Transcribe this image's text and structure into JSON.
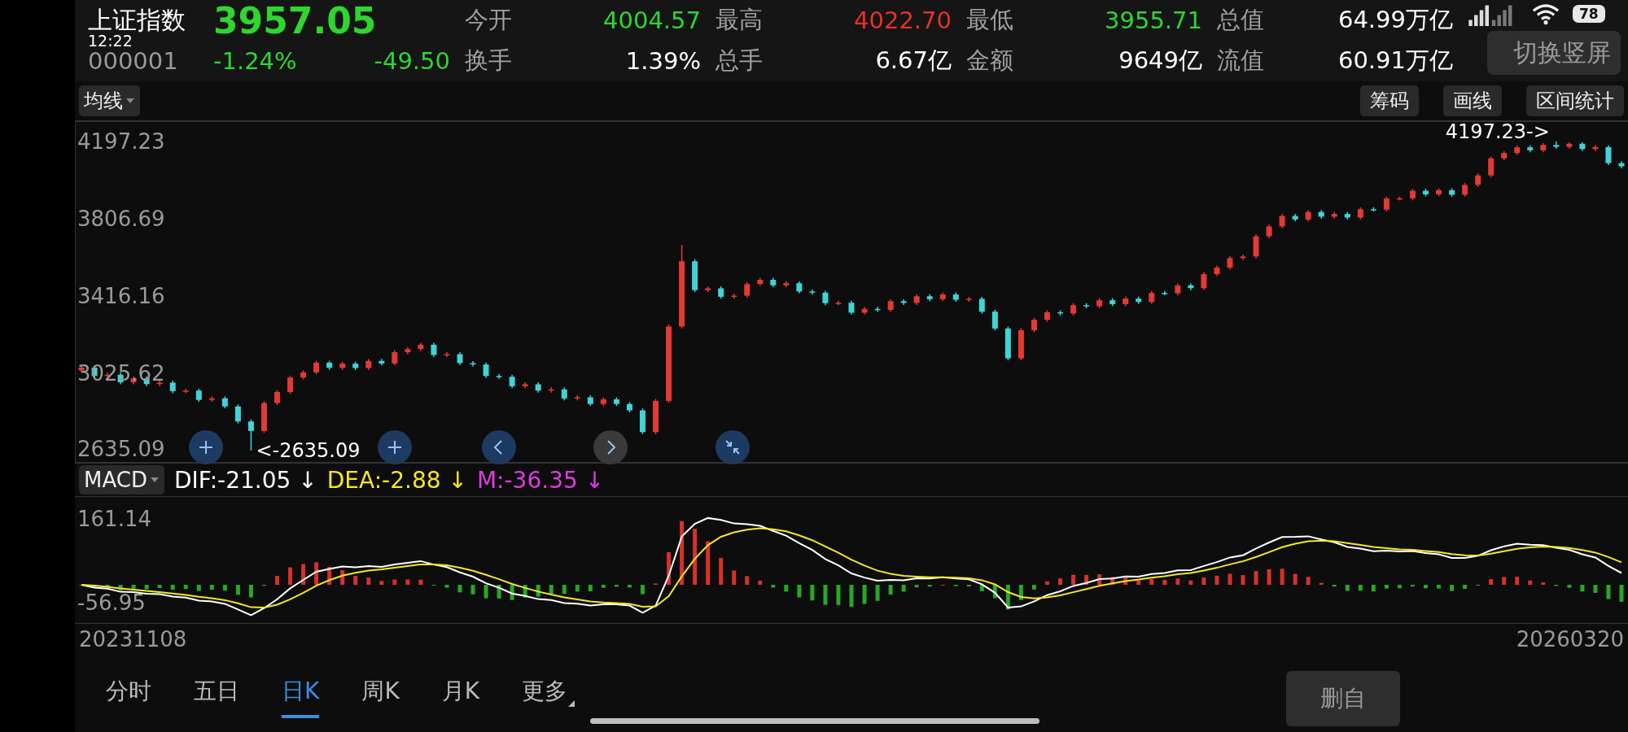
{
  "status_bar": {
    "time": "12:22",
    "battery": "78"
  },
  "quote": {
    "name": "上证指数",
    "code": "000001",
    "price": "3957.05",
    "change_percent": "-1.24%",
    "change": "-49.50",
    "color": "#2ed62e"
  },
  "stats": [
    {
      "label": "今开",
      "value": "4004.57",
      "color": "#2ed62e"
    },
    {
      "label": "最高",
      "value": "4022.70",
      "color": "#e8302a"
    },
    {
      "label": "最低",
      "value": "3955.71",
      "color": "#2ed62e"
    },
    {
      "label": "总值",
      "value": "64.99万亿",
      "color": "#ffffff"
    },
    {
      "label": "换手",
      "value": "1.39%",
      "color": "#ffffff"
    },
    {
      "label": "总手",
      "value": "6.67亿",
      "color": "#ffffff"
    },
    {
      "label": "金额",
      "value": "9649亿",
      "color": "#ffffff"
    },
    {
      "label": "流值",
      "value": "60.91万亿",
      "color": "#ffffff"
    }
  ],
  "orientation_button": "切换竖屏",
  "toolbar": {
    "indicator_dropdown": "均线",
    "buttons": [
      "筹码",
      "画线",
      "区间统计"
    ]
  },
  "chart": {
    "chart_data": {
      "type": "candlestick",
      "ylim": [
        2573,
        4300
      ],
      "yticks": [
        4197.23,
        3806.69,
        3416.16,
        3025.62,
        2635.09
      ],
      "annotations": [
        "<-2635.09",
        "4197.23->"
      ],
      "ohlc": [
        [
          3040,
          3064,
          3030,
          3054
        ],
        [
          3054,
          3064,
          3002,
          3012
        ],
        [
          3012,
          3028,
          3002,
          3018
        ],
        [
          3018,
          3028,
          2970,
          2980
        ],
        [
          2980,
          3010,
          2970,
          3000
        ],
        [
          3000,
          3010,
          2961,
          2971
        ],
        [
          2971,
          2988,
          2961,
          2978
        ],
        [
          2978,
          2988,
          2925,
          2935
        ],
        [
          2935,
          2948,
          2925,
          2938
        ],
        [
          2938,
          2948,
          2881,
          2891
        ],
        [
          2891,
          2909,
          2881,
          2899
        ],
        [
          2899,
          2909,
          2848,
          2858
        ],
        [
          2858,
          2868,
          2772,
          2782
        ],
        [
          2782,
          2792,
          2635.09,
          2734
        ],
        [
          2734,
          2885,
          2724,
          2875
        ],
        [
          2875,
          2941,
          2865,
          2931
        ],
        [
          2931,
          3014,
          2921,
          3004
        ],
        [
          3004,
          3040,
          2994,
          3030
        ],
        [
          3030,
          3089,
          3020,
          3079
        ],
        [
          3079,
          3089,
          3043,
          3053
        ],
        [
          3053,
          3084,
          3043,
          3074
        ],
        [
          3074,
          3084,
          3042,
          3052
        ],
        [
          3052,
          3098,
          3042,
          3088
        ],
        [
          3088,
          3098,
          3065,
          3075
        ],
        [
          3075,
          3142,
          3065,
          3132
        ],
        [
          3132,
          3158,
          3122,
          3148
        ],
        [
          3148,
          3180,
          3138,
          3170
        ],
        [
          3170,
          3180,
          3108,
          3118
        ],
        [
          3118,
          3132,
          3108,
          3122
        ],
        [
          3122,
          3132,
          3067,
          3077
        ],
        [
          3077,
          3087,
          3060,
          3070
        ],
        [
          3070,
          3080,
          3002,
          3012
        ],
        [
          3012,
          3022,
          2998,
          3008
        ],
        [
          3008,
          3018,
          2950,
          2960
        ],
        [
          2960,
          2980,
          2950,
          2970
        ],
        [
          2970,
          2980,
          2928,
          2938
        ],
        [
          2938,
          2954,
          2928,
          2944
        ],
        [
          2944,
          2954,
          2888,
          2898
        ],
        [
          2898,
          2914,
          2888,
          2904
        ],
        [
          2904,
          2914,
          2860,
          2870
        ],
        [
          2870,
          2904,
          2860,
          2894
        ],
        [
          2894,
          2904,
          2860,
          2870
        ],
        [
          2870,
          2880,
          2828,
          2838
        ],
        [
          2838,
          2848,
          2718,
          2728
        ],
        [
          2728,
          2896,
          2718,
          2886
        ],
        [
          2886,
          3272,
          2876,
          3262
        ],
        [
          3262,
          3674,
          3252,
          3592
        ],
        [
          3592,
          3602,
          3436,
          3446
        ],
        [
          3446,
          3465,
          3436,
          3455
        ],
        [
          3455,
          3465,
          3402,
          3412
        ],
        [
          3412,
          3428,
          3402,
          3418
        ],
        [
          3418,
          3487,
          3408,
          3477
        ],
        [
          3477,
          3508,
          3467,
          3498
        ],
        [
          3498,
          3508,
          3460,
          3470
        ],
        [
          3470,
          3491,
          3460,
          3481
        ],
        [
          3481,
          3491,
          3429,
          3439
        ],
        [
          3439,
          3449,
          3423,
          3433
        ],
        [
          3433,
          3443,
          3370,
          3380
        ],
        [
          3380,
          3392,
          3370,
          3382
        ],
        [
          3382,
          3392,
          3322,
          3332
        ],
        [
          3332,
          3361,
          3322,
          3351
        ],
        [
          3351,
          3361,
          3336,
          3346
        ],
        [
          3346,
          3400,
          3336,
          3390
        ],
        [
          3390,
          3400,
          3371,
          3381
        ],
        [
          3381,
          3425,
          3371,
          3415
        ],
        [
          3415,
          3425,
          3390,
          3400
        ],
        [
          3400,
          3434,
          3390,
          3424
        ],
        [
          3424,
          3434,
          3387,
          3397
        ],
        [
          3397,
          3412,
          3387,
          3402
        ],
        [
          3402,
          3412,
          3327,
          3337
        ],
        [
          3337,
          3347,
          3242,
          3252
        ],
        [
          3252,
          3262,
          3091,
          3101
        ],
        [
          3101,
          3253,
          3091,
          3243
        ],
        [
          3243,
          3306,
          3233,
          3296
        ],
        [
          3296,
          3344,
          3286,
          3334
        ],
        [
          3334,
          3344,
          3318,
          3328
        ],
        [
          3328,
          3380,
          3318,
          3370
        ],
        [
          3370,
          3380,
          3354,
          3364
        ],
        [
          3364,
          3405,
          3354,
          3395
        ],
        [
          3395,
          3405,
          3365,
          3375
        ],
        [
          3375,
          3413,
          3365,
          3403
        ],
        [
          3403,
          3413,
          3376,
          3386
        ],
        [
          3386,
          3442,
          3376,
          3432
        ],
        [
          3432,
          3442,
          3420,
          3430
        ],
        [
          3430,
          3480,
          3420,
          3470
        ],
        [
          3470,
          3480,
          3446,
          3456
        ],
        [
          3456,
          3537,
          3446,
          3527
        ],
        [
          3527,
          3570,
          3517,
          3560
        ],
        [
          3560,
          3618,
          3550,
          3608
        ],
        [
          3608,
          3626,
          3598,
          3616
        ],
        [
          3616,
          3728,
          3606,
          3718
        ],
        [
          3718,
          3778,
          3708,
          3768
        ],
        [
          3768,
          3831,
          3758,
          3821
        ],
        [
          3821,
          3831,
          3793,
          3803
        ],
        [
          3803,
          3851,
          3793,
          3841
        ],
        [
          3841,
          3851,
          3807,
          3817
        ],
        [
          3817,
          3841,
          3807,
          3831
        ],
        [
          3831,
          3841,
          3803,
          3813
        ],
        [
          3813,
          3865,
          3803,
          3855
        ],
        [
          3855,
          3865,
          3843,
          3853
        ],
        [
          3853,
          3919,
          3843,
          3909
        ],
        [
          3909,
          3919,
          3900,
          3910
        ],
        [
          3910,
          3958,
          3900,
          3948
        ],
        [
          3948,
          3958,
          3920,
          3930
        ],
        [
          3930,
          3961,
          3920,
          3951
        ],
        [
          3951,
          3961,
          3918,
          3928
        ],
        [
          3928,
          3988,
          3918,
          3978
        ],
        [
          3978,
          4036,
          3968,
          4026
        ],
        [
          4026,
          4122,
          4016,
          4112
        ],
        [
          4112,
          4149,
          4102,
          4139
        ],
        [
          4139,
          4178,
          4129,
          4168
        ],
        [
          4168,
          4178,
          4143,
          4153
        ],
        [
          4153,
          4190,
          4143,
          4180
        ],
        [
          4180,
          4197.23,
          4160,
          4170
        ],
        [
          4170,
          4193,
          4160,
          4186
        ],
        [
          4186,
          4193,
          4149,
          4159
        ],
        [
          4159,
          4179,
          4149,
          4169
        ],
        [
          4169,
          4179,
          4078,
          4088
        ],
        [
          4088,
          4098,
          4062,
          4072
        ]
      ]
    }
  },
  "macd": {
    "dropdown": "MACD",
    "legend": [
      {
        "text": "DIF:-21.05 ↓",
        "color": "#ffffff"
      },
      {
        "text": "DEA:-2.88 ↓",
        "color": "#f5e52a"
      },
      {
        "text": "M:-36.35 ↓",
        "color": "#e03be0"
      }
    ],
    "y_labels": [
      "161.14",
      "-56.95"
    ]
  },
  "dates": {
    "start": "20231108",
    "end": "20260320"
  },
  "tabs": [
    {
      "label": "分时",
      "selected": false,
      "kind": "period"
    },
    {
      "label": "五日",
      "selected": false,
      "kind": "period"
    },
    {
      "label": "日K",
      "selected": true,
      "kind": "period"
    },
    {
      "label": "周K",
      "selected": false,
      "kind": "period"
    },
    {
      "label": "月K",
      "selected": false,
      "kind": "period"
    },
    {
      "label": "更多",
      "selected": false,
      "kind": "menu"
    }
  ],
  "floating_button": "删自"
}
